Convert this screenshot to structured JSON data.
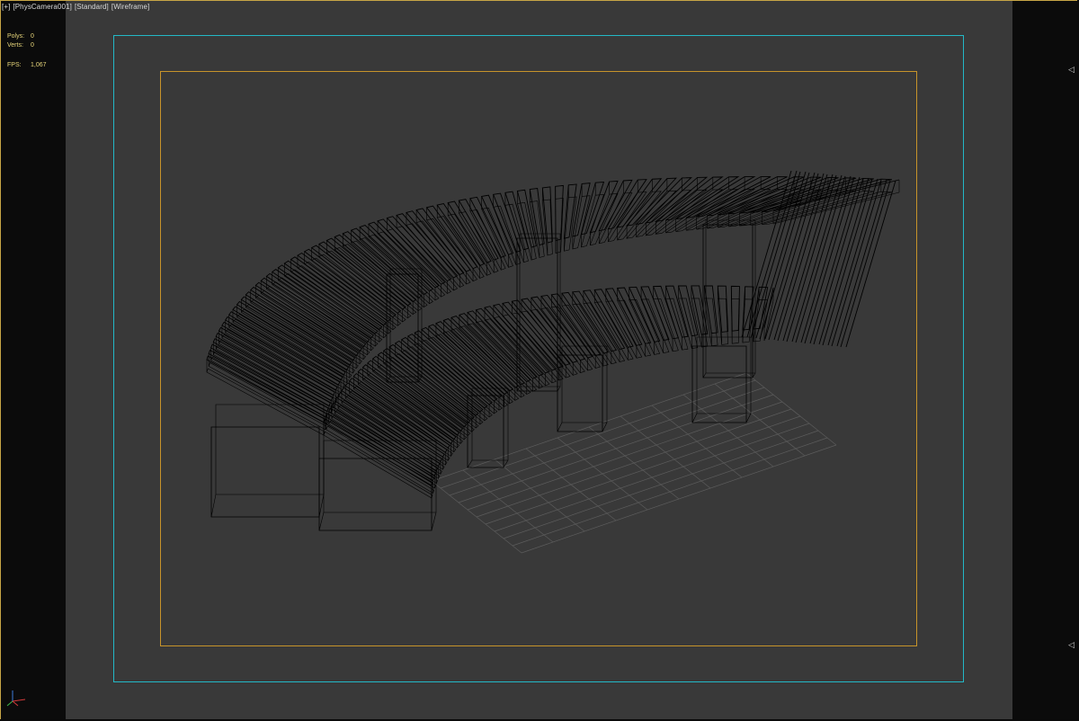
{
  "viewport": {
    "labels": [
      {
        "text": "[+]",
        "name": "viewport-menu-label"
      },
      {
        "text": "[PhysCamera001]",
        "name": "camera-label"
      },
      {
        "text": "[Standard]",
        "name": "shading-mode-label"
      },
      {
        "text": "[Wireframe]",
        "name": "display-mode-label"
      }
    ],
    "stats": {
      "polys_label": "Polys:",
      "polys_value": "0",
      "verts_label": "Verts:",
      "verts_value": "0",
      "fps_label": "FPS:",
      "fps_value": "1,067"
    },
    "right_markers": [
      "◁",
      "◁"
    ]
  },
  "colors": {
    "frame_border": "#c8a646",
    "viewport_bg": "#393939",
    "safe_frame_outer": "#23b9c7",
    "safe_frame_inner": "#c7942b",
    "stats_text": "#e7d57a",
    "wireframe": "#000000",
    "grid": "#5c5c5c"
  },
  "icons": {
    "axis_gizmo": "xyz-axis-icon",
    "viewport_arrow": "triangle-left-icon"
  }
}
